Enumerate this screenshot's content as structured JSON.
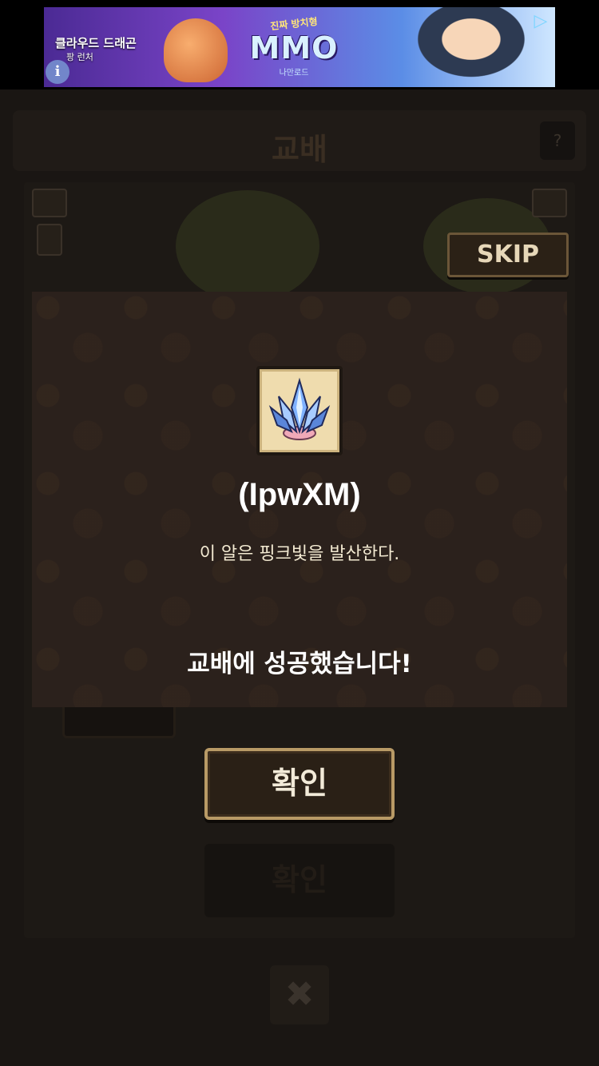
{
  "ad": {
    "left_text": "클라우드 드래곤",
    "left_sub": "팡 런처",
    "mid_top": "진짜 방치형",
    "mid_title": "MMO",
    "mid_sub": "나만로드",
    "info_glyph": "i",
    "play_glyph": "▷"
  },
  "header": {
    "title": "교배",
    "help_label": "?"
  },
  "skip_label": "SKIP",
  "dialog": {
    "item_icon": "blue-crystal-egg-icon",
    "item_name": "(IpwXM)",
    "item_description": "이 알은 핑크빛을 발산한다.",
    "result_message": "교배에 성공했습니다!"
  },
  "buttons": {
    "confirm_label": "확인",
    "confirm_dim_label": "확인",
    "close_glyph": "✖"
  },
  "colors": {
    "dialog_bg": "#2b211c",
    "button_border": "#b89a66",
    "skip_border": "#6b5638"
  }
}
